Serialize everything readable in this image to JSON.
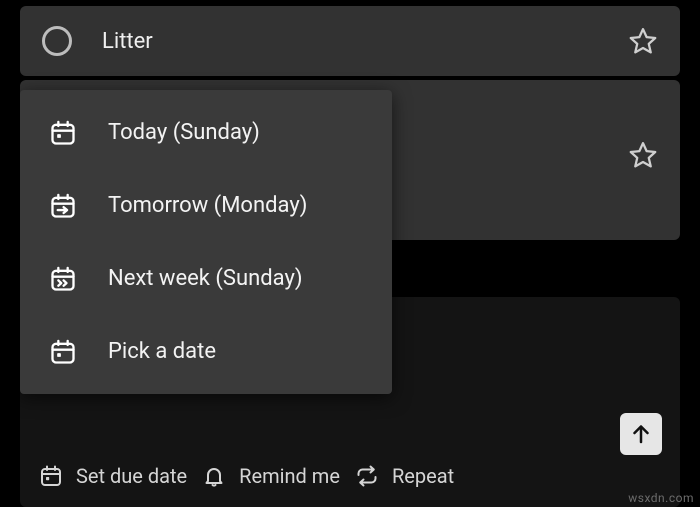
{
  "tasks": [
    {
      "title": "Litter"
    }
  ],
  "menu": [
    {
      "label": "Today (Sunday)"
    },
    {
      "label": "Tomorrow (Monday)"
    },
    {
      "label": "Next week (Sunday)"
    },
    {
      "label": "Pick a date"
    }
  ],
  "actions": {
    "due": "Set due date",
    "remind": "Remind me",
    "repeat": "Repeat"
  },
  "watermark": "wsxdn.com"
}
